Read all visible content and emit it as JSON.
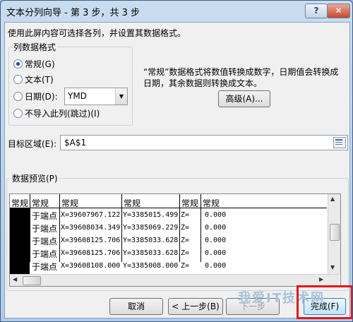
{
  "window": {
    "title": "文本分列向导 - 第 3 步，共 3 步",
    "help_label": "?",
    "close_label": "✕"
  },
  "intro": "使用此屏内容可选择各列，并设置其数据格式。",
  "format_group": {
    "title": "列数据格式",
    "options": [
      {
        "label": "常规(G)",
        "checked": true
      },
      {
        "label": "文本(T)",
        "checked": false
      },
      {
        "label": "日期(D):",
        "checked": false
      },
      {
        "label": "不导入此列(跳过)(I)",
        "checked": false
      }
    ],
    "date_format_value": "YMD"
  },
  "description": "“常规”数据格式将数值转换成数字，日期值会转换成日期，其余数据则转换成文本。",
  "advanced_button": "高级(A)...",
  "destination": {
    "label": "目标区域(E):",
    "value": "$A$1",
    "icon": "range-select-icon"
  },
  "preview": {
    "label": "数据预览(P)",
    "headers": [
      "常规",
      "常规",
      "常规",
      "常规",
      "常规",
      "常规"
    ],
    "rows": [
      [
        "",
        "于端点",
        "X=39607967.122",
        "Y=3385015.499",
        "Z=",
        "0.000"
      ],
      [
        "",
        "于端点",
        "X=39608034.349",
        "Y=3385069.229",
        "Z=",
        "0.000"
      ],
      [
        "",
        "于端点",
        "X=39608125.706",
        "Y=3385033.628",
        "Z=",
        "0.000"
      ],
      [
        "",
        "于端点",
        "X=39608125.706",
        "Y=3385033.628",
        "Z=",
        "0.000"
      ],
      [
        "",
        "于端点",
        "X=39608108.000",
        "Y=3385008.000",
        "Z=",
        "0.000"
      ]
    ]
  },
  "buttons": {
    "cancel": "取消",
    "back": "< 上一步(B)",
    "next": "下一步",
    "finish": "完成(F)"
  },
  "watermark": "我爱IT技术网"
}
